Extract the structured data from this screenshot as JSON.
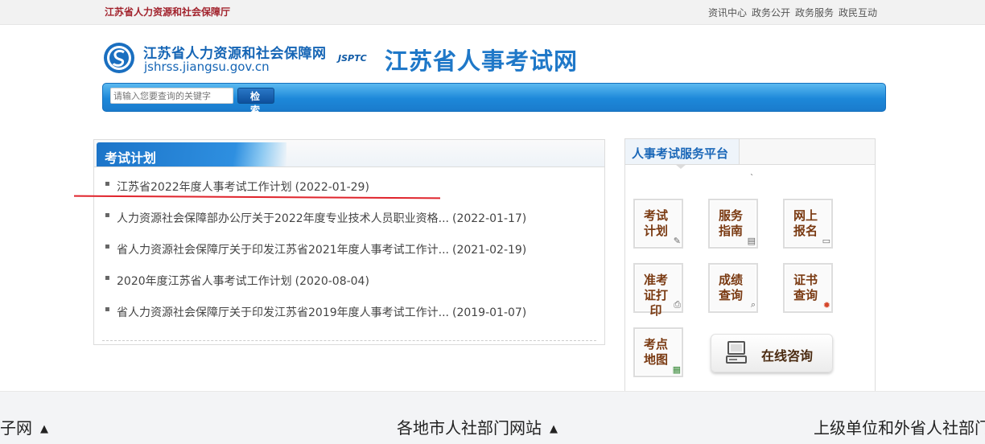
{
  "topbar": {
    "org": "江苏省人力资源和社会保障厅",
    "links": [
      "资讯中心",
      "政务公开",
      "政务服务",
      "政民互动"
    ]
  },
  "header": {
    "logo_cn": "江苏省人力资源和社会保障网",
    "logo_en": "jshrss.jiangsu.gov.cn",
    "jsptc": "JSPTC",
    "site_title": "江苏省人事考试网"
  },
  "search": {
    "placeholder": "请输入您要查询的关键字",
    "button_label": "检 索"
  },
  "exam_plan": {
    "title": "考试计划",
    "items": [
      {
        "title": "江苏省2022年度人事考试工作计划",
        "date": "(2022-01-29)"
      },
      {
        "title": "人力资源社会保障部办公厅关于2022年度专业技术人员职业资格...",
        "date": "(2022-01-17)"
      },
      {
        "title": "省人力资源社会保障厅关于印发江苏省2021年度人事考试工作计...",
        "date": "(2021-02-19)"
      },
      {
        "title": "2020年度江苏省人事考试工作计划",
        "date": "(2020-08-04)"
      },
      {
        "title": "省人力资源社会保障厅关于印发江苏省2019年度人事考试工作计...",
        "date": "(2019-01-07)"
      }
    ]
  },
  "service_platform": {
    "title": "人事考试服务平台",
    "dot": "`",
    "services": [
      {
        "label": "考试计划",
        "icon": "pen-icon"
      },
      {
        "label": "服务指南",
        "icon": "document-icon"
      },
      {
        "label": "网上报名",
        "icon": "computer-icon"
      },
      {
        "label": "准考证打印",
        "icon": "printer-icon"
      },
      {
        "label": "成绩查询",
        "icon": "magnifier-icon"
      },
      {
        "label": "证书查询",
        "icon": "medal-icon"
      },
      {
        "label": "考点地图",
        "icon": "map-icon"
      }
    ],
    "consult_label": "在线咨询"
  },
  "footer": {
    "items": [
      "业务子网",
      "各地市人社部门网站",
      "上级单位和外省人社部门"
    ],
    "arrow": "▲"
  }
}
